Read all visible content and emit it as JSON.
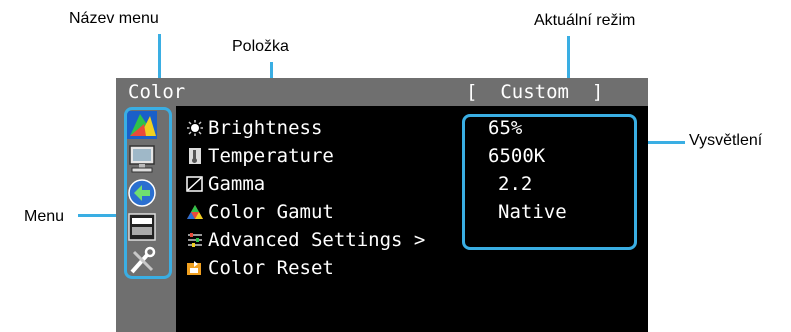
{
  "callouts": {
    "menu_name": "Název menu",
    "item": "Položka",
    "current_mode": "Aktuální režim",
    "explanation": "Vysvětlení",
    "menu": "Menu"
  },
  "osd": {
    "menu_title": "Color",
    "mode_display": "[  Custom  ]",
    "side_icons": [
      "color-icon",
      "monitor-icon",
      "signal-icon",
      "language-icon",
      "tools-icon"
    ],
    "items": [
      {
        "label": "Brightness",
        "icon": "sun-icon",
        "value": "65%"
      },
      {
        "label": "Temperature",
        "icon": "thermometer-icon",
        "value": "6500K"
      },
      {
        "label": "Gamma",
        "icon": "gamma-icon",
        "value": "2.2"
      },
      {
        "label": "Color Gamut",
        "icon": "triangle-icon",
        "value": "Native"
      },
      {
        "label": "Advanced Settings >",
        "icon": "sliders-icon",
        "value": ""
      },
      {
        "label": "Color Reset",
        "icon": "reset-icon",
        "value": ""
      }
    ]
  },
  "colors": {
    "accent": "#3aaee3",
    "titlebar": "#6f6f6f",
    "screen": "#000000"
  }
}
